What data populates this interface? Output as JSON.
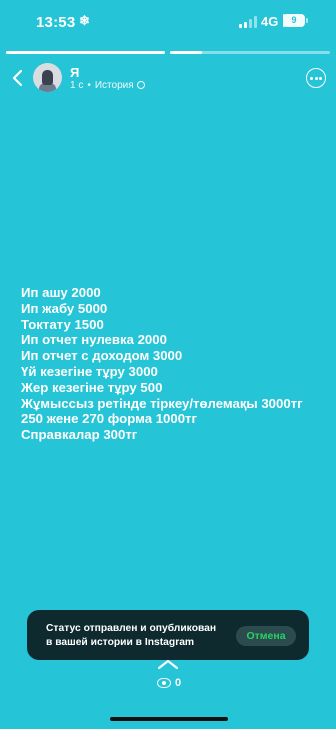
{
  "status_bar": {
    "time": "13:53",
    "time_icon": "snowflake-icon",
    "network": "4G",
    "battery": "9",
    "battery_level": 0.09
  },
  "progress": {
    "segments": 2,
    "segment_fill": [
      1.0,
      0.2
    ]
  },
  "header": {
    "username": "Я",
    "time_ago": "1 с",
    "separator": "•",
    "type": "История",
    "privacy_icon": "globe-icon"
  },
  "story": {
    "lines": [
      "Ип ашу 2000",
      "Ип жабу 5000",
      "Токтату 1500",
      "Ип отчет нулевка 2000",
      "Ип отчет с доходом 3000",
      "Үй кезегіне тұру 3000",
      "Жер кезегіне тұру 500",
      "Жұмыссыз ретінде тіркеу/төлемақы 3000тг",
      "250 жене 270 форма  1000тг",
      "Справкалар 300тг"
    ]
  },
  "toast": {
    "line1": "Статус отправлен и опубликован",
    "line2": "в вашей истории в Instagram",
    "cancel_label": "Отмена"
  },
  "footer": {
    "viewer_count": "0"
  },
  "colors": {
    "background": "#25c4d6",
    "toast_bg": "#0f2a2f",
    "cancel_text": "#25d366"
  }
}
